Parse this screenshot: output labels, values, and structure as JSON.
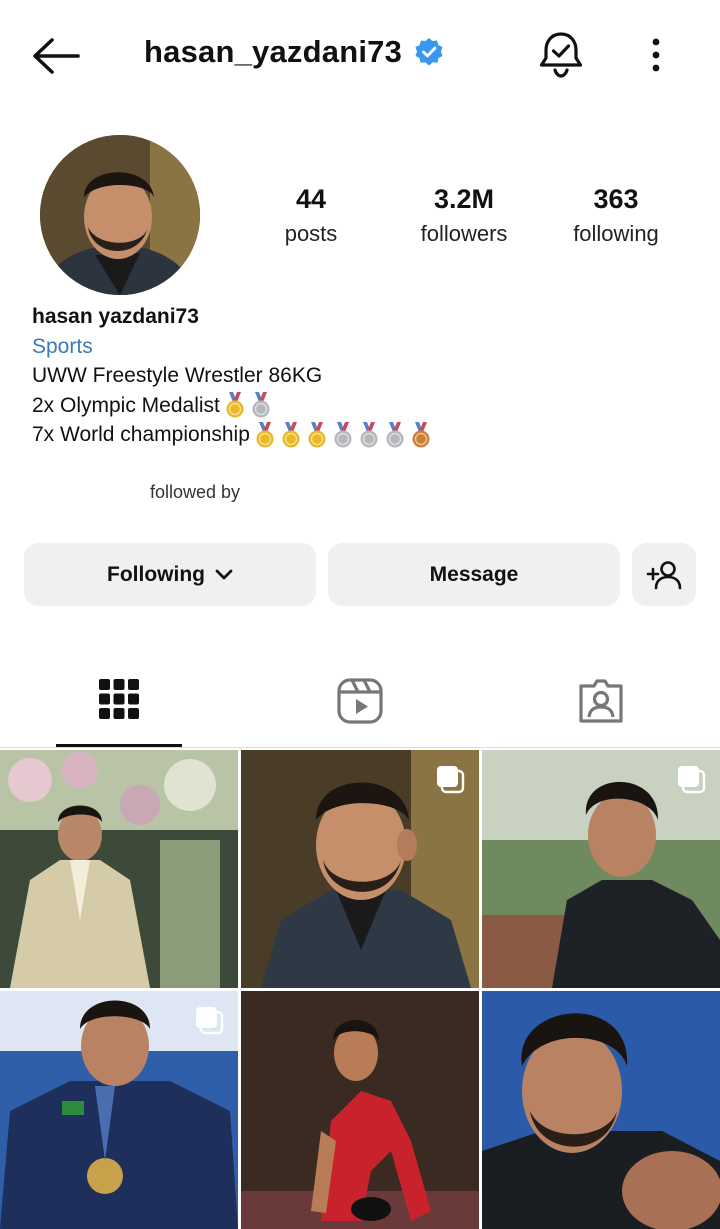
{
  "header": {
    "username": "hasan_yazdani73",
    "verified": true,
    "icons": [
      "back-arrow-icon",
      "verified-badge-icon",
      "notification-bell-icon",
      "more-options-icon"
    ]
  },
  "profile": {
    "stats": [
      {
        "value": "44",
        "label": "posts"
      },
      {
        "value": "3.2M",
        "label": "followers"
      },
      {
        "value": "363",
        "label": "following"
      }
    ],
    "name": "hasan yazdani73",
    "category": "Sports",
    "bio_lines": [
      "UWW Freestyle Wrestler 86KG",
      "2x Olympic Medalist",
      "7x World championship"
    ],
    "medals_line2": [
      "gold",
      "silver"
    ],
    "medals_line3": [
      "gold",
      "gold",
      "gold",
      "silver",
      "silver",
      "silver",
      "bronze"
    ],
    "followed_by": "followed by"
  },
  "actions": {
    "following_label": "Following",
    "message_label": "Message"
  },
  "tabs": [
    "grid",
    "reels",
    "tagged"
  ],
  "colors": {
    "accent_blue": "#3b7ab8",
    "verified_blue": "#3897f0",
    "button_bg": "#eff0f2"
  },
  "posts": [
    {
      "multi": false
    },
    {
      "multi": true
    },
    {
      "multi": true
    },
    {
      "multi": true
    },
    {
      "multi": false
    },
    {
      "multi": false
    }
  ]
}
